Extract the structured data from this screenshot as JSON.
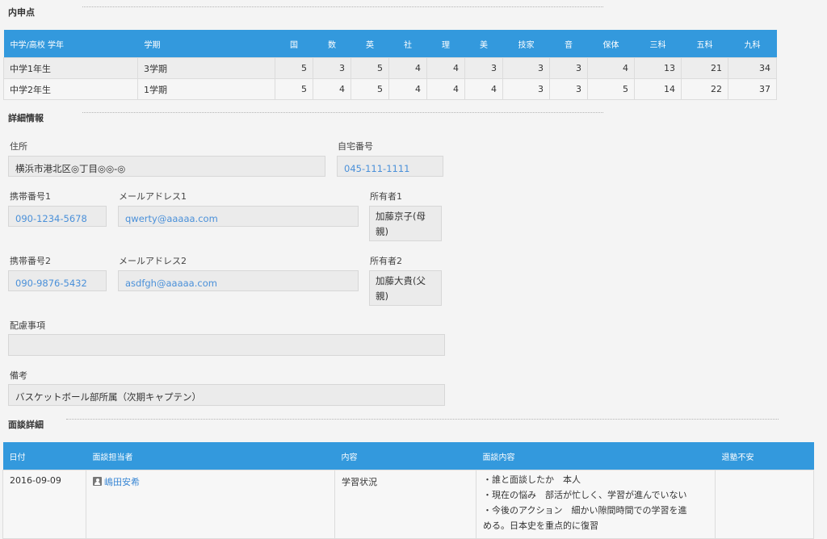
{
  "grades_section": {
    "title": "内申点",
    "headers": [
      "中学/高校 学年",
      "学期",
      "国",
      "数",
      "英",
      "社",
      "理",
      "美",
      "技家",
      "音",
      "保体",
      "三科",
      "五科",
      "九科"
    ],
    "rows": [
      [
        "中学1年生",
        "3学期",
        "5",
        "3",
        "5",
        "4",
        "4",
        "3",
        "3",
        "3",
        "4",
        "13",
        "21",
        "34"
      ],
      [
        "中学2年生",
        "1学期",
        "5",
        "4",
        "5",
        "4",
        "4",
        "4",
        "3",
        "3",
        "5",
        "14",
        "22",
        "37"
      ]
    ]
  },
  "details_section": {
    "title": "詳細情報",
    "address": {
      "label": "住所",
      "value": "横浜市港北区◎丁目◎◎-◎"
    },
    "home_phone": {
      "label": "自宅番号",
      "value": "045-111-1111"
    },
    "mobile1": {
      "label": "携帯番号1",
      "value": "090-1234-5678"
    },
    "email1": {
      "label": "メールアドレス1",
      "value": "qwerty@aaaaa.com"
    },
    "owner1": {
      "label": "所有者1",
      "value": "加藤京子(母親)"
    },
    "mobile2": {
      "label": "携帯番号2",
      "value": "090-9876-5432"
    },
    "email2": {
      "label": "メールアドレス2",
      "value": "asdfgh@aaaaa.com"
    },
    "owner2": {
      "label": "所有者2",
      "value": "加藤大貴(父親)"
    },
    "considerations": {
      "label": "配慮事項",
      "value": ""
    },
    "notes": {
      "label": "備考",
      "value": "バスケットボール部所属（次期キャプテン）"
    }
  },
  "interview_section": {
    "title": "面談詳細",
    "headers": {
      "date": "日付",
      "staff": "面談担当者",
      "topic": "内容",
      "content": "面談内容",
      "anxiety": "退塾不安"
    },
    "rows": [
      {
        "date": "2016-09-09",
        "staff": "嶋田安希",
        "staff_icon": "person-icon",
        "topic": "学習状況",
        "content_lines": [
          "・誰と面談したか　本人",
          "・現在の悩み　部活が忙しく、学習が進んでいない",
          "・今後のアクション　細かい隙間時間での学習を進",
          "める。日本史を重点的に復習"
        ],
        "anxiety": ""
      }
    ]
  },
  "colors": {
    "header_bg": "#3399dd",
    "link": "#4a90d9"
  }
}
